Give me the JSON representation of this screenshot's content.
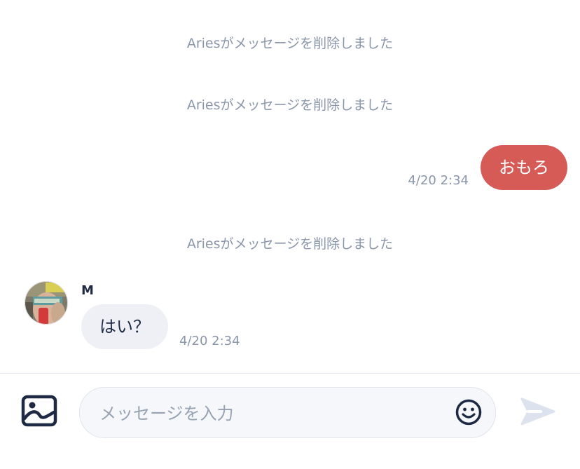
{
  "messages": {
    "system_1": "Ariesがメッセージを削除しました",
    "system_2": "Ariesがメッセージを削除しました",
    "outgoing": {
      "text": "おもろ",
      "time": "4/20 2:34",
      "bubble_color": "#d65a55"
    },
    "system_3": "Ariesがメッセージを削除しました",
    "incoming": {
      "sender": "M",
      "text": "はい？",
      "time": "4/20 2:34",
      "bubble_color": "#eef0f5"
    }
  },
  "composer": {
    "placeholder": "メッセージを入力",
    "image_icon": "image-icon",
    "emoji_icon": "smiley-icon",
    "send_icon": "send-icon"
  },
  "colors": {
    "accent": "#d65a55",
    "muted_text": "#8a96aa",
    "primary_text": "#1e2a44"
  }
}
